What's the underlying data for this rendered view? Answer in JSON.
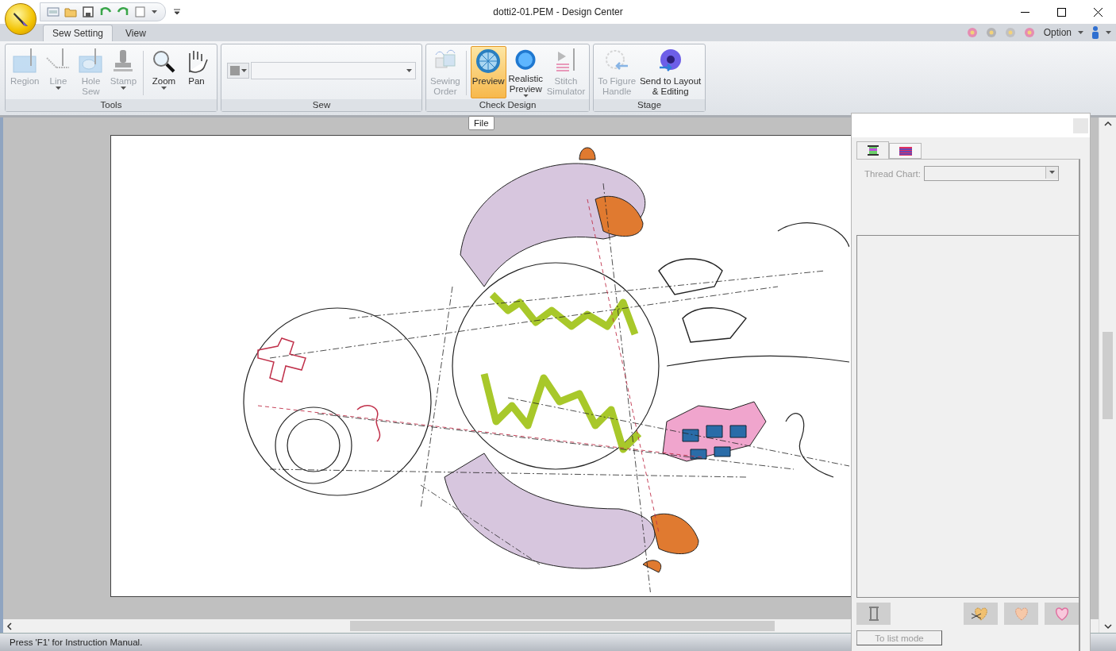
{
  "window": {
    "title": "dotti2-01.PEM - Design Center"
  },
  "tabs": [
    {
      "label": "Sew Setting",
      "selected": true
    },
    {
      "label": "View",
      "selected": false
    }
  ],
  "option_menu": {
    "label": "Option"
  },
  "ribbon": {
    "groups": [
      {
        "label": "Tools",
        "buttons": [
          {
            "kind": "region",
            "label": "Region",
            "disabled": true,
            "selected": false,
            "dropdown": false
          },
          {
            "kind": "line",
            "label": "Line",
            "disabled": true,
            "selected": false,
            "dropdown": true
          },
          {
            "kind": "hole",
            "label": "Hole\nSew",
            "disabled": true,
            "selected": false,
            "dropdown": false
          },
          {
            "kind": "stamp",
            "label": "Stamp",
            "disabled": true,
            "selected": false,
            "dropdown": true
          },
          {
            "kind": "zoom",
            "label": "Zoom",
            "disabled": false,
            "selected": false,
            "dropdown": true
          },
          {
            "kind": "pan",
            "label": "Pan",
            "disabled": false,
            "selected": false,
            "dropdown": false
          }
        ]
      },
      {
        "label": "Sew"
      },
      {
        "label": "Check Design",
        "buttons": [
          {
            "kind": "order",
            "label": "Sewing\nOrder",
            "disabled": true,
            "selected": false,
            "dropdown": false
          },
          {
            "kind": "preview",
            "label": "Preview",
            "disabled": false,
            "selected": true,
            "dropdown": false
          },
          {
            "kind": "realistic",
            "label": "Realistic\nPreview",
            "disabled": false,
            "selected": false,
            "dropdown": true
          },
          {
            "kind": "simulator",
            "label": "Stitch\nSimulator",
            "disabled": true,
            "selected": false,
            "dropdown": false
          }
        ]
      },
      {
        "label": "Stage",
        "buttons": [
          {
            "kind": "handle",
            "label": "To Figure\nHandle",
            "disabled": true,
            "selected": false,
            "dropdown": false
          },
          {
            "kind": "send",
            "label": "Send to Layout\n& Editing",
            "disabled": false,
            "selected": false,
            "dropdown": false
          }
        ]
      }
    ]
  },
  "tooltip": {
    "label": "File"
  },
  "panel": {
    "tabs": [
      {
        "kind": "spool",
        "selected": true
      },
      {
        "kind": "chart",
        "selected": false
      }
    ],
    "thread_chart": {
      "label": "Thread Chart:",
      "disabled": true
    },
    "list_mode_button": {
      "label": "To list mode",
      "disabled": true
    }
  },
  "status_bar": {
    "text": "Press 'F1' for Instruction Manual."
  }
}
